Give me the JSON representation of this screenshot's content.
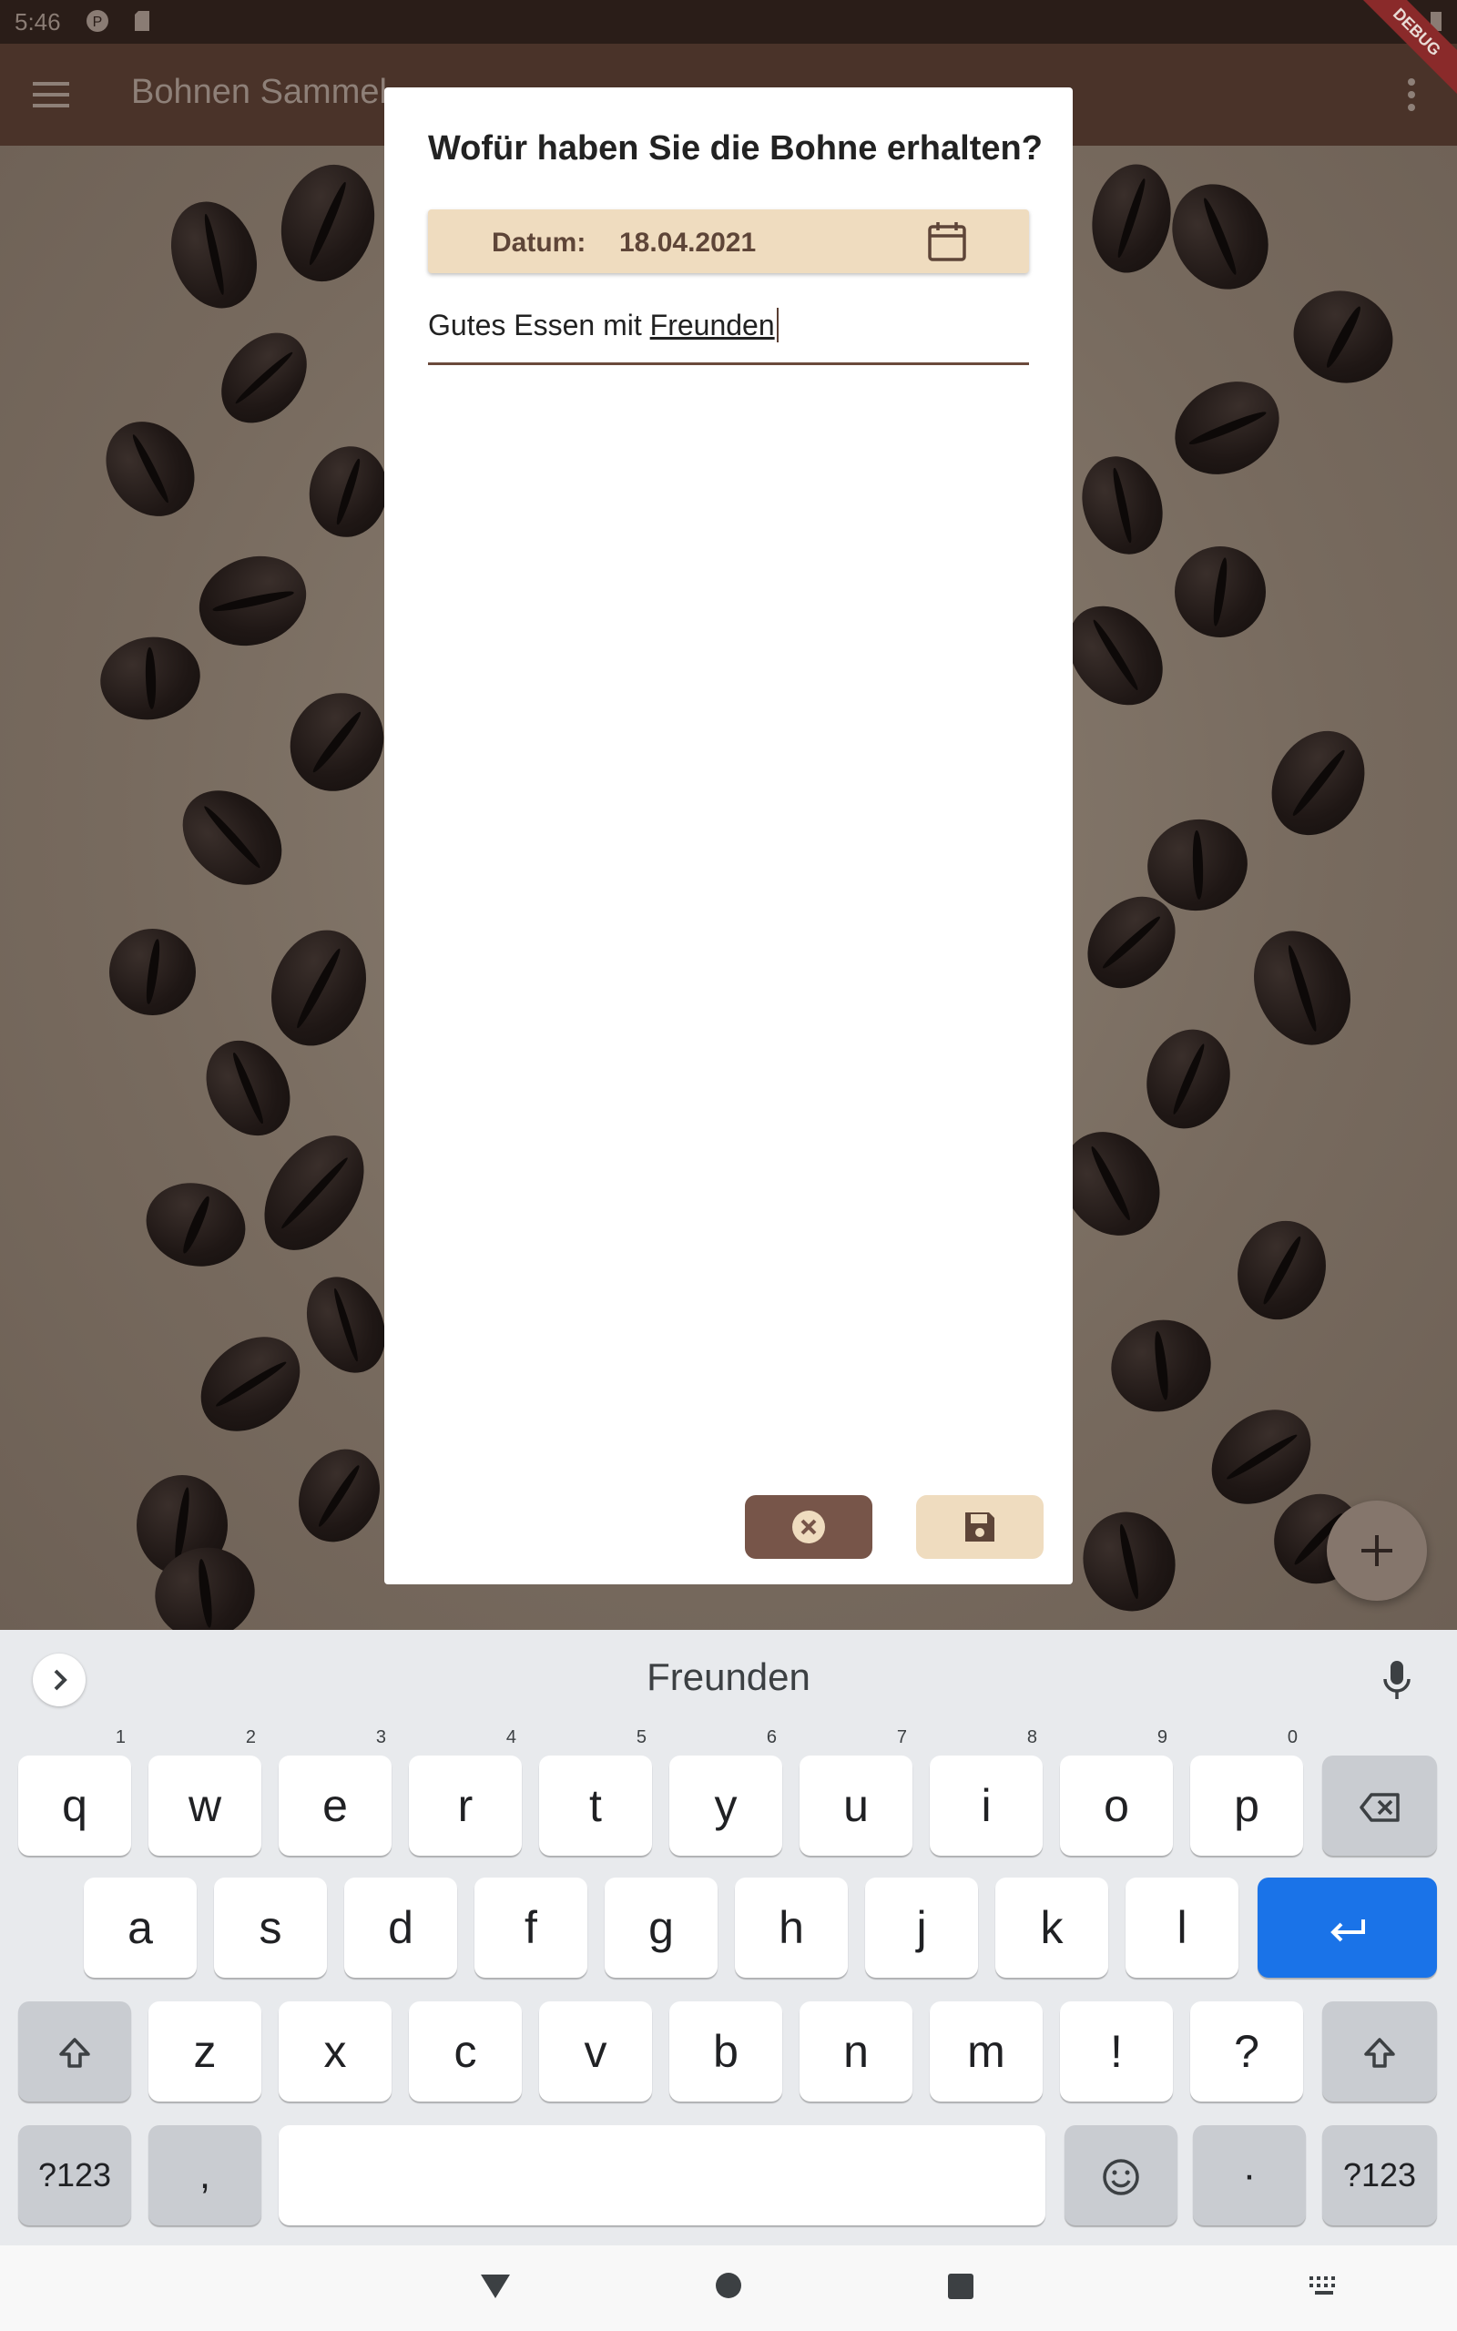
{
  "status_bar": {
    "time": "5:46",
    "icons": [
      "notification-icon",
      "sd-card-icon",
      "wifi-icon",
      "battery-icon"
    ]
  },
  "app_bar": {
    "title": "Bohnen Sammel",
    "debug_banner": "DEBUG"
  },
  "dialog": {
    "title": "Wofür haben Sie die Bohne erhalten?",
    "date_label": "Datum:",
    "date_value": "18.04.2021",
    "reason_text_plain": "Gutes Essen mit ",
    "reason_text_composing": "Freunden",
    "cancel_icon": "cancel-icon",
    "save_icon": "save-icon"
  },
  "keyboard": {
    "suggestion": "Freunden",
    "row1": [
      {
        "label": "q",
        "hint": "1"
      },
      {
        "label": "w",
        "hint": "2"
      },
      {
        "label": "e",
        "hint": "3"
      },
      {
        "label": "r",
        "hint": "4"
      },
      {
        "label": "t",
        "hint": "5"
      },
      {
        "label": "y",
        "hint": "6"
      },
      {
        "label": "u",
        "hint": "7"
      },
      {
        "label": "i",
        "hint": "8"
      },
      {
        "label": "o",
        "hint": "9"
      },
      {
        "label": "p",
        "hint": "0"
      }
    ],
    "row2": [
      "a",
      "s",
      "d",
      "f",
      "g",
      "h",
      "j",
      "k",
      "l"
    ],
    "row3": [
      "z",
      "x",
      "c",
      "v",
      "b",
      "n",
      "m",
      "!",
      "?"
    ],
    "symbols_label": "?123",
    "comma_label": ",",
    "period_label": "·"
  },
  "colors": {
    "app_bar": "#4a3329",
    "accent_beige": "#efdcbf",
    "accent_brown": "#775549",
    "enter_key": "#1a73e8"
  }
}
